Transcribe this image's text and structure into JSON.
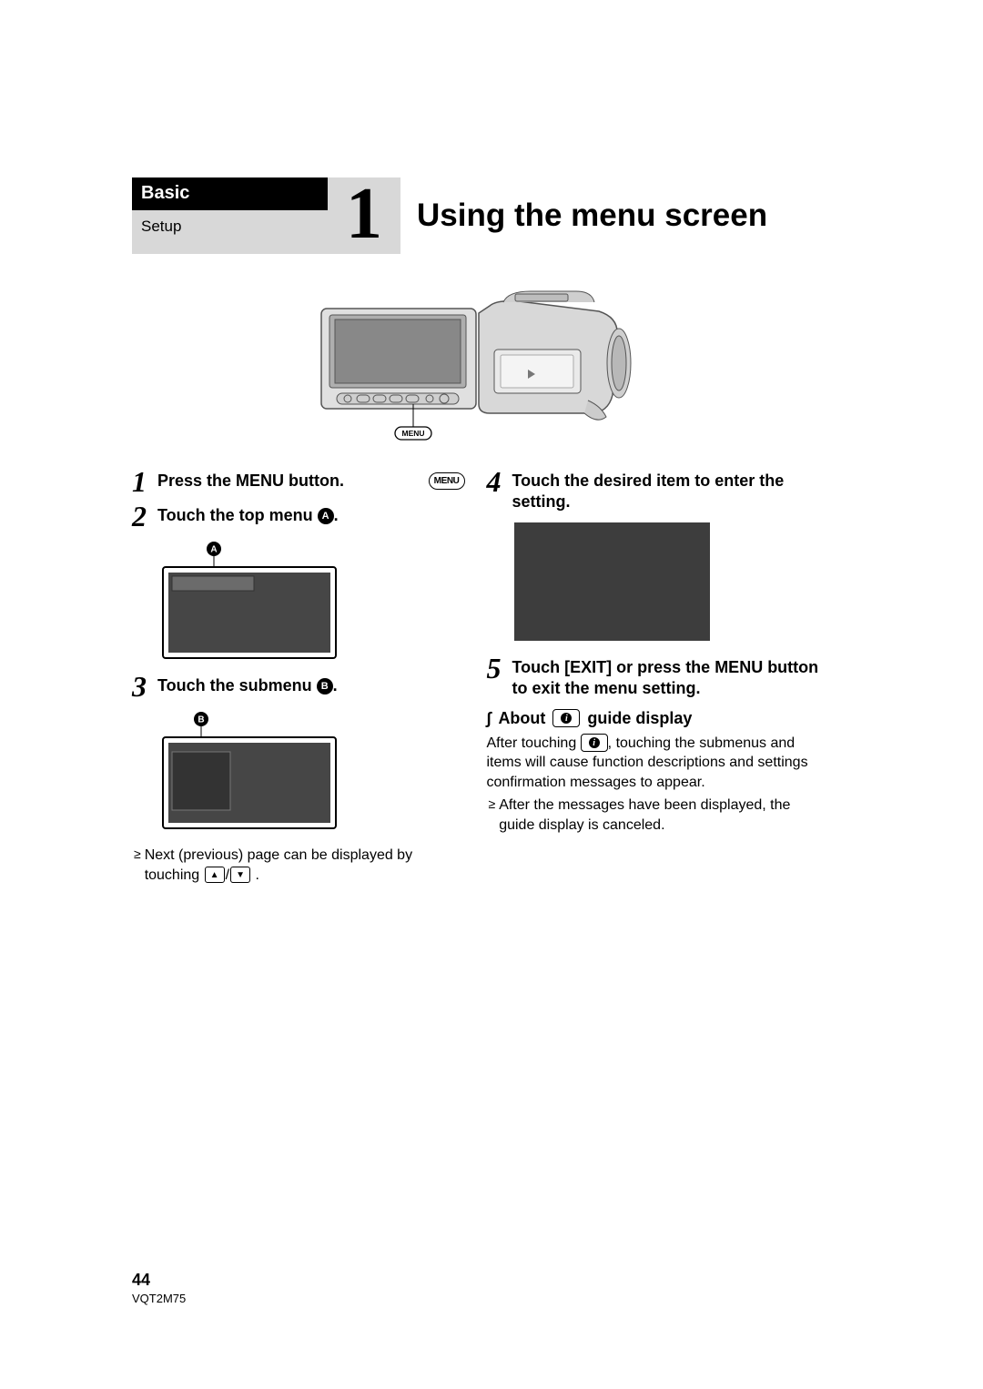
{
  "header": {
    "category": "Basic",
    "section": "Setup",
    "chapter_number": "1",
    "title": "Using the menu screen"
  },
  "menu_label": "MENU",
  "steps": {
    "s1": {
      "num": "1",
      "text": "Press the MENU button."
    },
    "s2": {
      "num": "2",
      "text_before": "Touch the top menu ",
      "marker": "A",
      "text_after": "."
    },
    "s3": {
      "num": "3",
      "text_before": "Touch the submenu ",
      "marker": "B",
      "text_after": "."
    },
    "s4": {
      "num": "4",
      "text": "Touch the desired item to enter the setting."
    },
    "s5": {
      "num": "5",
      "text": "Touch [EXIT] or press the MENU button to exit the menu setting."
    }
  },
  "note_paging": {
    "line1": "Next (previous) page can be displayed by touching ",
    "line2_after": " ."
  },
  "about": {
    "heading_before": "About",
    "heading_after": "guide display",
    "body_before": "After touching ",
    "body_after": ", touching the submenus and items will cause function descriptions and settings confirmation messages to appear.",
    "bullet": "After the messages have been displayed, the guide display is canceled."
  },
  "footer": {
    "page_number": "44",
    "doc_id": "VQT2M75"
  },
  "markers": {
    "a": "A",
    "b": "B"
  }
}
